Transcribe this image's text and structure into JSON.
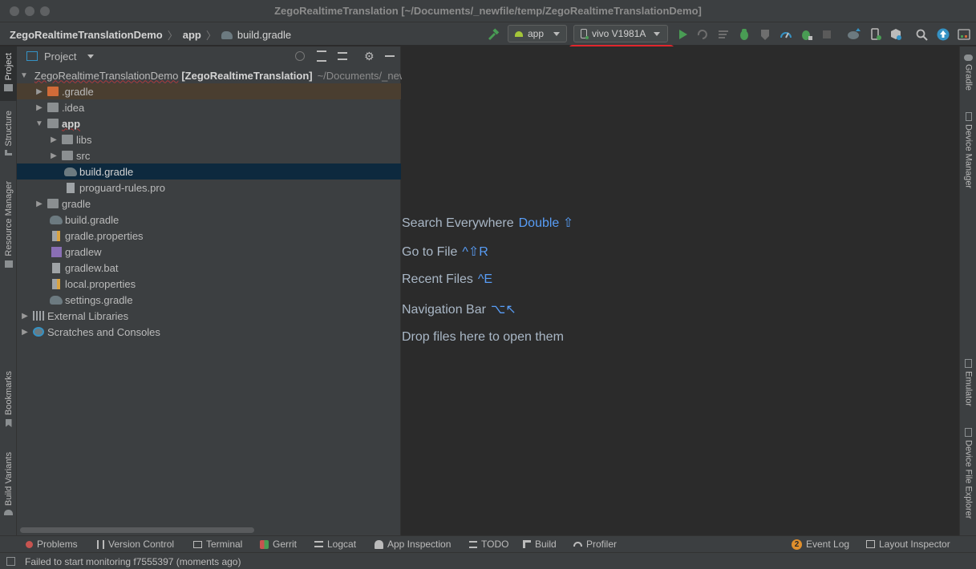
{
  "window": {
    "title": "ZegoRealtimeTranslation [~/Documents/_newfile/temp/ZegoRealtimeTranslationDemo]"
  },
  "breadcrumb": {
    "project": "ZegoRealtimeTranslationDemo",
    "module": "app",
    "file": "build.gradle"
  },
  "toolbar": {
    "run_config": "app",
    "device": "vivo V1981A"
  },
  "left_stripe": {
    "project": "Project",
    "structure": "Structure",
    "resource_manager": "Resource Manager",
    "bookmarks": "Bookmarks",
    "build_variants": "Build Variants"
  },
  "right_stripe": {
    "gradle": "Gradle",
    "device_manager": "Device Manager",
    "emulator": "Emulator",
    "device_file_explorer": "Device File Explorer"
  },
  "project_panel": {
    "title": "Project",
    "root_name": "ZegoRealtimeTranslationDemo",
    "root_module": "[ZegoRealtimeTranslation]",
    "root_path": "~/Documents/_newfile/temp/ZegoRealtimeTranslationDemo",
    "items": [
      {
        "label": ".gradle"
      },
      {
        "label": ".idea"
      },
      {
        "label": "app"
      },
      {
        "label": "libs"
      },
      {
        "label": "src"
      },
      {
        "label": "build.gradle"
      },
      {
        "label": "proguard-rules.pro"
      },
      {
        "label": "gradle"
      },
      {
        "label": "build.gradle"
      },
      {
        "label": "gradle.properties"
      },
      {
        "label": "gradlew"
      },
      {
        "label": "gradlew.bat"
      },
      {
        "label": "local.properties"
      },
      {
        "label": "settings.gradle"
      },
      {
        "label": "External Libraries"
      },
      {
        "label": "Scratches and Consoles"
      }
    ]
  },
  "editor_hints": {
    "search_label": "Search Everywhere",
    "search_key": "Double ⇧",
    "goto_label": "Go to File",
    "goto_key": "^⇧R",
    "recent_label": "Recent Files",
    "recent_key": "^E",
    "nav_label": "Navigation Bar",
    "nav_key": "⌥↖",
    "drop_label": "Drop files here to open them"
  },
  "bottom_tabs": {
    "problems": "Problems",
    "version_control": "Version Control",
    "terminal": "Terminal",
    "gerrit": "Gerrit",
    "logcat": "Logcat",
    "app_inspection": "App Inspection",
    "todo": "TODO",
    "build": "Build",
    "profiler": "Profiler",
    "event_log_count": "2",
    "event_log": "Event Log",
    "layout_inspector": "Layout Inspector"
  },
  "status": {
    "message": "Failed to start monitoring f7555397 (moments ago)"
  },
  "colors": {
    "accent": "#589df6",
    "highlight": "#e0262c",
    "selection": "#0d293e",
    "run_green": "#499c54"
  }
}
